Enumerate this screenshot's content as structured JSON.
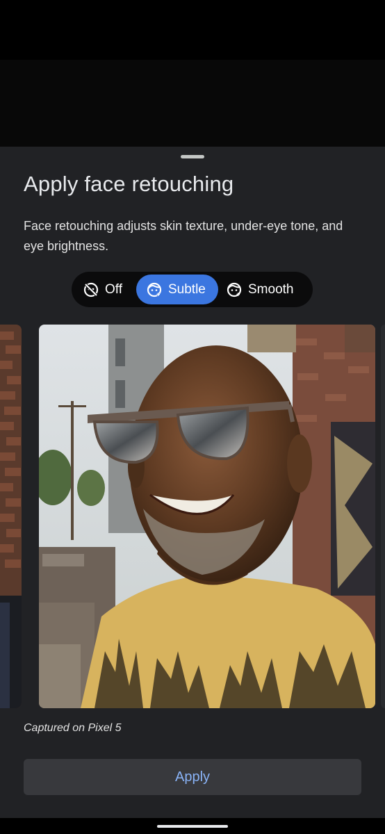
{
  "sheet": {
    "title": "Apply face retouching",
    "description": "Face retouching adjusts skin texture, under-eye tone, and eye brightness."
  },
  "segments": {
    "off_label": "Off",
    "subtle_label": "Subtle",
    "smooth_label": "Smooth",
    "selected": "Subtle",
    "off_icon": "face-off-icon",
    "subtle_icon": "face-retouch-icon",
    "smooth_icon": "face-retouch-icon"
  },
  "photo": {
    "caption": "Captured on Pixel 5"
  },
  "actions": {
    "apply_label": "Apply"
  },
  "colors": {
    "sheet_bg": "#212225",
    "selected_segment": "#3b76e0",
    "apply_text": "#8ab4f8",
    "apply_bg": "#38393d"
  }
}
